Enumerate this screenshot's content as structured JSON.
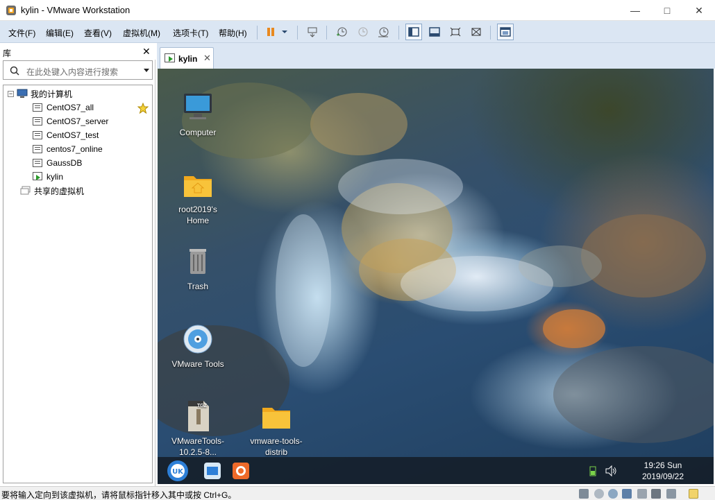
{
  "window": {
    "title": "kylin - VMware Workstation"
  },
  "menu": {
    "items": [
      "文件(F)",
      "编辑(E)",
      "查看(V)",
      "虚拟机(M)",
      "选项卡(T)",
      "帮助(H)"
    ]
  },
  "library": {
    "title": "库",
    "search_placeholder": "在此处键入内容进行搜索",
    "root": "我的计算机",
    "vms": [
      "CentOS7_all",
      "CentOS7_server",
      "CentOS7_test",
      "centos7_online",
      "GaussDB",
      "kylin"
    ],
    "shared": "共享的虚拟机"
  },
  "tab": {
    "label": "kylin"
  },
  "desktop": {
    "icons": {
      "computer": "Computer",
      "home": "root2019's Home",
      "trash": "Trash",
      "vmtools": "VMware Tools",
      "tarball": "VMwareTools-10.2.5-8...",
      "folder": "vmware-tools-distrib"
    },
    "tgz_label": "TGZ",
    "clock_time": "19:26 Sun",
    "clock_date": "2019/09/22"
  },
  "status": {
    "text": "要将输入定向到该虚拟机，请将鼠标指针移入其中或按 Ctrl+G。"
  },
  "colors": {
    "menubar": "#dbe6f3",
    "pause_orange": "#e8891f",
    "taskbar": "#141e28"
  }
}
